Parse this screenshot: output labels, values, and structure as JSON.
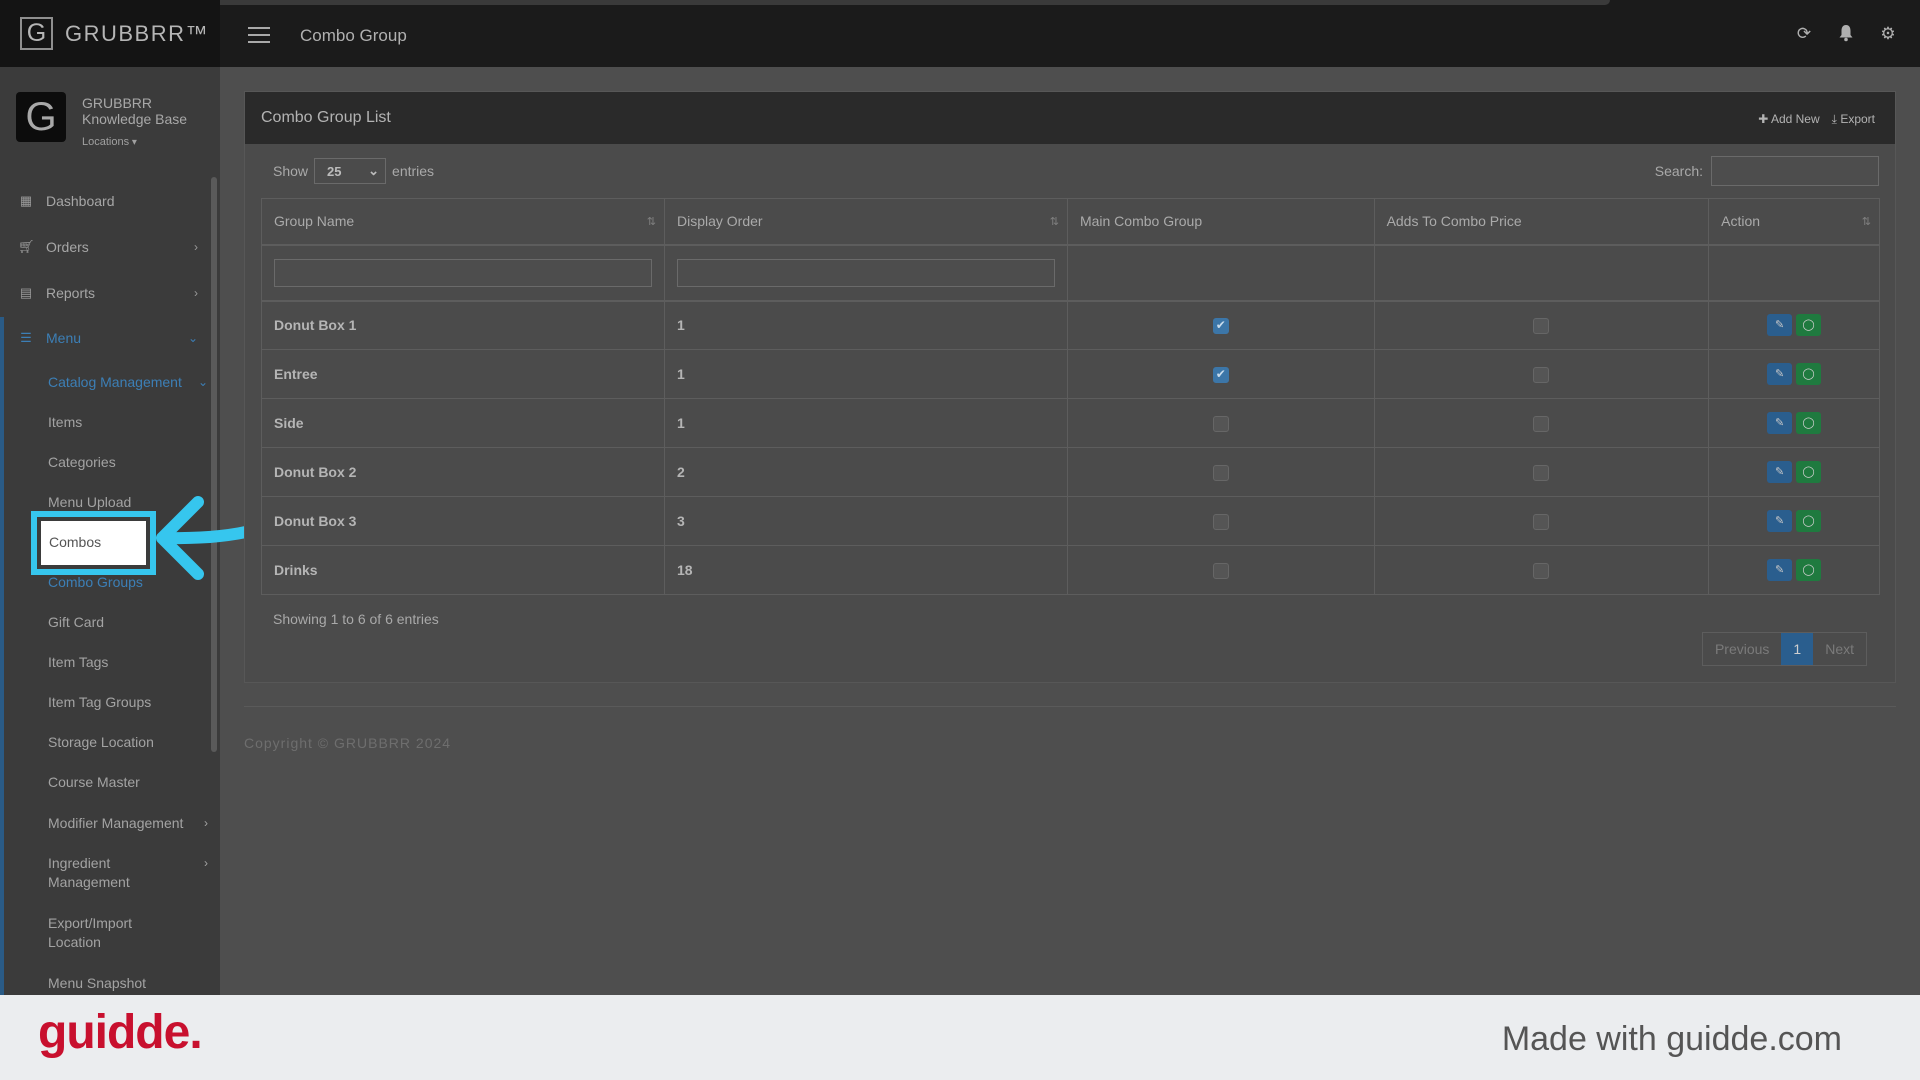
{
  "app": {
    "brand_initial": "G",
    "brand_name": "GRUBBRR™",
    "page_title": "Combo Group"
  },
  "profile": {
    "initial": "G",
    "name_line1": "GRUBBRR",
    "name_line2": "Knowledge Base",
    "locations_label": "Locations"
  },
  "nav": {
    "dashboard": "Dashboard",
    "orders": "Orders",
    "reports": "Reports",
    "menu": "Menu"
  },
  "submenu": {
    "catalog_management": "Catalog Management",
    "items": "Items",
    "categories": "Categories",
    "menu_upload": "Menu Upload",
    "combos": "Combos",
    "combo_groups": "Combo Groups",
    "gift_card": "Gift Card",
    "item_tags": "Item Tags",
    "item_tag_groups": "Item Tag Groups",
    "storage_location": "Storage Location",
    "course_master": "Course Master",
    "modifier_management": "Modifier Management",
    "ingredient_line1": "Ingredient",
    "ingredient_line2": "Management",
    "export_line1": "Export/Import",
    "export_line2": "Location",
    "menu_snapshot": "Menu Snapshot"
  },
  "card": {
    "title": "Combo Group List",
    "add_new": "Add New",
    "export": "Export",
    "show_label": "Show",
    "entries_value": "25",
    "entries_label": "entries",
    "search_label": "Search:",
    "showing_text": "Showing 1 to 6 of 6 entries"
  },
  "table": {
    "headers": [
      "Group Name",
      "Display Order",
      "Main Combo Group",
      "Adds To Combo Price",
      "Action"
    ],
    "rows": [
      {
        "name": "Donut Box 1",
        "order": "1",
        "main": true,
        "adds": false
      },
      {
        "name": "Entree",
        "order": "1",
        "main": true,
        "adds": false
      },
      {
        "name": "Side",
        "order": "1",
        "main": false,
        "adds": false
      },
      {
        "name": "Donut Box 2",
        "order": "2",
        "main": false,
        "adds": false
      },
      {
        "name": "Donut Box 3",
        "order": "3",
        "main": false,
        "adds": false
      },
      {
        "name": "Drinks",
        "order": "18",
        "main": false,
        "adds": false
      }
    ]
  },
  "pager": {
    "previous": "Previous",
    "current": "1",
    "next": "Next"
  },
  "footer": {
    "copyright": "Copyright © GRUBBRR 2024"
  },
  "banner": {
    "logo": "guidde.",
    "made_with": "Made with guidde.com"
  },
  "colors": {
    "highlight": "#36c6ee",
    "accent_blue": "#3c7fb6",
    "guidde_red": "#c8102e"
  }
}
